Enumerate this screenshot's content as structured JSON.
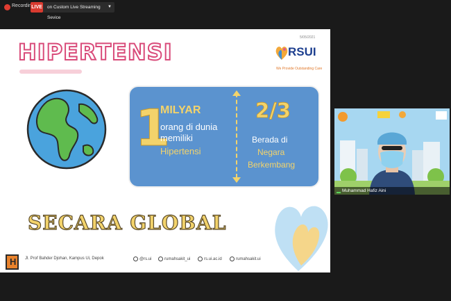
{
  "recording": {
    "label": "Recording"
  },
  "live": {
    "badge": "LIVE",
    "service": "on Custom Live Streaming Sevice"
  },
  "slide": {
    "date": "5/05/2021",
    "title": "HIPERTENSI",
    "brand": "RSUI",
    "tagline": "We Provide Outstanding Care",
    "stat1": {
      "number": "1",
      "unit": "MILYAR",
      "line1": "orang di dunia",
      "line2": "memiliki",
      "line3": "Hipertensi"
    },
    "stat2": {
      "fraction": "2/3",
      "line1": "Berada di",
      "line2": "Negara",
      "line3": "Berkembang"
    },
    "subtitle": "SECARA GLOBAL",
    "footer": {
      "address": "Jl. Prof Bahder Djohan, Kampus Ui, Depok",
      "instagram": "@rs.ui",
      "twitter": "rumahsakit_ui",
      "web": "rs.ui.ac.id",
      "facebook": "rumahsakit.ui"
    }
  },
  "participant": {
    "name": "Muhammad Hafiz Aini"
  },
  "colors": {
    "accent_yellow": "#f3d36b",
    "box_blue": "#5b93cf",
    "title_pink": "#d94b7a",
    "brand_blue": "#1d3f8f"
  }
}
